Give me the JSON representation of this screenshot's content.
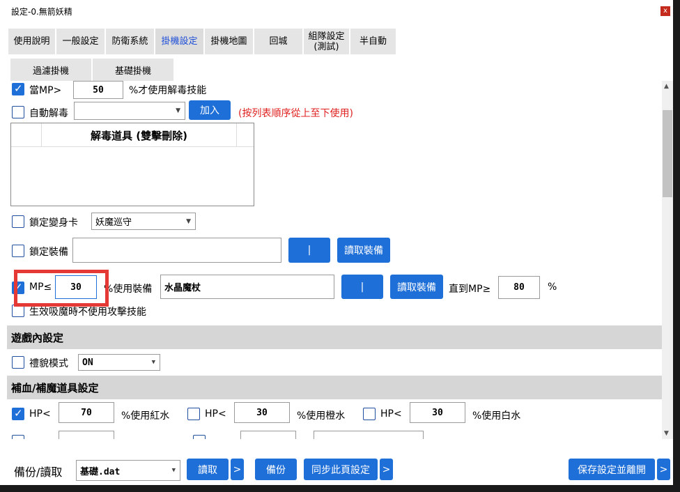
{
  "window": {
    "title": "設定-0.無箭妖精",
    "close": "x"
  },
  "tabs": [
    {
      "label": "使用說明"
    },
    {
      "label": "一般設定"
    },
    {
      "label": "防衛系統"
    },
    {
      "label": "掛機設定"
    },
    {
      "label": "掛機地圖"
    },
    {
      "label": "回城"
    },
    {
      "label": "組隊設定\n(測試)"
    },
    {
      "label": "半自動"
    }
  ],
  "subtabs": [
    {
      "label": "過濾掛機"
    },
    {
      "label": "基礎掛機"
    }
  ],
  "cure": {
    "mp_label": "當MP>",
    "mp_value": "50",
    "mp_suffix": "%才使用解毒技能",
    "auto_label": "自動解毒",
    "auto_select": "",
    "add_button": "加入",
    "hint": "(按列表順序從上至下使用)",
    "list_header": "解毒道具 (雙擊刪除)"
  },
  "lock_card": {
    "label": "鎖定變身卡",
    "select": "妖魔巡守"
  },
  "lock_equip": {
    "label": "鎖定裝備",
    "value": "",
    "pipe_button": "|",
    "read_button": "讀取裝備"
  },
  "mp_equip": {
    "label": "MP≤",
    "value": "30",
    "suffix": "%使用裝備",
    "equip": "水晶魔杖",
    "pipe_button": "|",
    "read_button": "讀取裝備",
    "until_label": "直到MP≥",
    "until_value": "80",
    "percent": "%"
  },
  "drain": {
    "label": "生效吸魔時不使用攻擊技能"
  },
  "game_section": {
    "title": "遊戲內設定"
  },
  "courtesy": {
    "label": "禮貌模式",
    "select": "ON"
  },
  "potion_section": {
    "title": "補血/補魔道具設定"
  },
  "potions": [
    {
      "label": "HP<",
      "value": "70",
      "suffix": "%使用紅水"
    },
    {
      "label": "HP<",
      "value": "30",
      "suffix": "%使用橙水"
    },
    {
      "label": "HP<",
      "value": "30",
      "suffix": "%使用白水"
    }
  ],
  "bottom": {
    "backup_label": "備份/讀取",
    "file": "基礎.dat",
    "read_button": "讀取",
    "more": ">",
    "backup_button": "備份",
    "sync_button": "同步此頁設定",
    "save_button": "保存設定並離開"
  }
}
